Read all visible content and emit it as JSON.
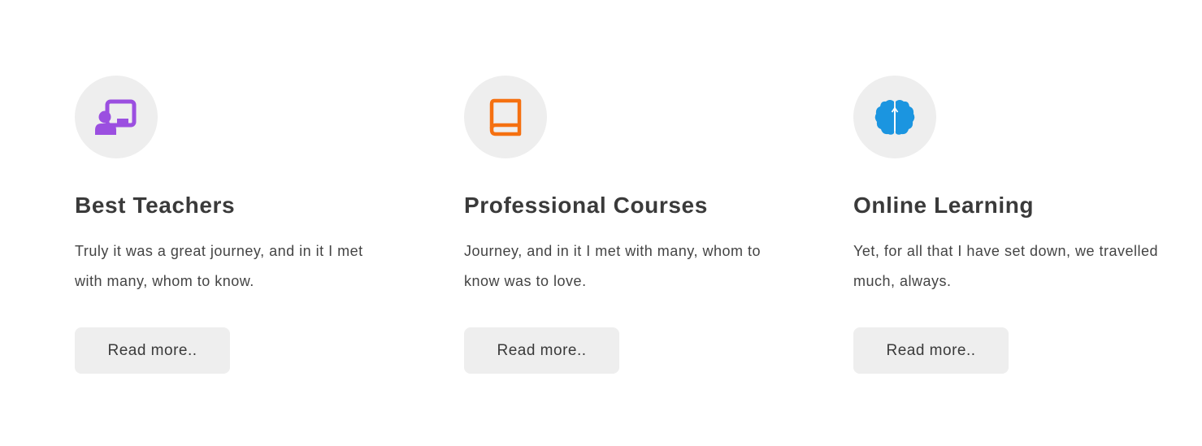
{
  "features": [
    {
      "icon": "teacher-presentation-icon",
      "icon_color": "#9b4fe0",
      "title": "Best Teachers",
      "text": "Truly it was a great journey, and in it I met with many, whom to know.",
      "button_label": "Read more.."
    },
    {
      "icon": "book-icon",
      "icon_color": "#f57010",
      "title": "Professional Courses",
      "text": "Journey, and in it I met with many, whom to know was to love.",
      "button_label": "Read more.."
    },
    {
      "icon": "brain-icon",
      "icon_color": "#1b95e0",
      "title": "Online Learning",
      "text": "Yet, for all that I have set down, we travelled much, always.",
      "button_label": "Read more.."
    }
  ],
  "colors": {
    "icon_circle_bg": "#eeeeee",
    "button_bg": "#eeeeee",
    "title_color": "#3a3a3a",
    "text_color": "#444444"
  }
}
